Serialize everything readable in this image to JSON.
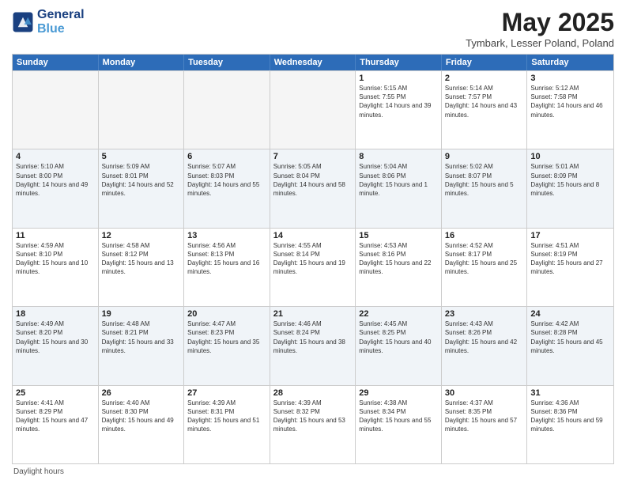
{
  "header": {
    "logo_general": "General",
    "logo_blue": "Blue",
    "main_title": "May 2025",
    "subtitle": "Tymbark, Lesser Poland, Poland"
  },
  "weekdays": [
    "Sunday",
    "Monday",
    "Tuesday",
    "Wednesday",
    "Thursday",
    "Friday",
    "Saturday"
  ],
  "footer_note": "Daylight hours",
  "rows": [
    [
      {
        "day": "",
        "empty": true
      },
      {
        "day": "",
        "empty": true
      },
      {
        "day": "",
        "empty": true
      },
      {
        "day": "",
        "empty": true
      },
      {
        "day": "1",
        "sunrise": "5:15 AM",
        "sunset": "7:55 PM",
        "daylight": "14 hours and 39 minutes."
      },
      {
        "day": "2",
        "sunrise": "5:14 AM",
        "sunset": "7:57 PM",
        "daylight": "14 hours and 43 minutes."
      },
      {
        "day": "3",
        "sunrise": "5:12 AM",
        "sunset": "7:58 PM",
        "daylight": "14 hours and 46 minutes."
      }
    ],
    [
      {
        "day": "4",
        "sunrise": "5:10 AM",
        "sunset": "8:00 PM",
        "daylight": "14 hours and 49 minutes."
      },
      {
        "day": "5",
        "sunrise": "5:09 AM",
        "sunset": "8:01 PM",
        "daylight": "14 hours and 52 minutes."
      },
      {
        "day": "6",
        "sunrise": "5:07 AM",
        "sunset": "8:03 PM",
        "daylight": "14 hours and 55 minutes."
      },
      {
        "day": "7",
        "sunrise": "5:05 AM",
        "sunset": "8:04 PM",
        "daylight": "14 hours and 58 minutes."
      },
      {
        "day": "8",
        "sunrise": "5:04 AM",
        "sunset": "8:06 PM",
        "daylight": "15 hours and 1 minute."
      },
      {
        "day": "9",
        "sunrise": "5:02 AM",
        "sunset": "8:07 PM",
        "daylight": "15 hours and 5 minutes."
      },
      {
        "day": "10",
        "sunrise": "5:01 AM",
        "sunset": "8:09 PM",
        "daylight": "15 hours and 8 minutes."
      }
    ],
    [
      {
        "day": "11",
        "sunrise": "4:59 AM",
        "sunset": "8:10 PM",
        "daylight": "15 hours and 10 minutes."
      },
      {
        "day": "12",
        "sunrise": "4:58 AM",
        "sunset": "8:12 PM",
        "daylight": "15 hours and 13 minutes."
      },
      {
        "day": "13",
        "sunrise": "4:56 AM",
        "sunset": "8:13 PM",
        "daylight": "15 hours and 16 minutes."
      },
      {
        "day": "14",
        "sunrise": "4:55 AM",
        "sunset": "8:14 PM",
        "daylight": "15 hours and 19 minutes."
      },
      {
        "day": "15",
        "sunrise": "4:53 AM",
        "sunset": "8:16 PM",
        "daylight": "15 hours and 22 minutes."
      },
      {
        "day": "16",
        "sunrise": "4:52 AM",
        "sunset": "8:17 PM",
        "daylight": "15 hours and 25 minutes."
      },
      {
        "day": "17",
        "sunrise": "4:51 AM",
        "sunset": "8:19 PM",
        "daylight": "15 hours and 27 minutes."
      }
    ],
    [
      {
        "day": "18",
        "sunrise": "4:49 AM",
        "sunset": "8:20 PM",
        "daylight": "15 hours and 30 minutes."
      },
      {
        "day": "19",
        "sunrise": "4:48 AM",
        "sunset": "8:21 PM",
        "daylight": "15 hours and 33 minutes."
      },
      {
        "day": "20",
        "sunrise": "4:47 AM",
        "sunset": "8:23 PM",
        "daylight": "15 hours and 35 minutes."
      },
      {
        "day": "21",
        "sunrise": "4:46 AM",
        "sunset": "8:24 PM",
        "daylight": "15 hours and 38 minutes."
      },
      {
        "day": "22",
        "sunrise": "4:45 AM",
        "sunset": "8:25 PM",
        "daylight": "15 hours and 40 minutes."
      },
      {
        "day": "23",
        "sunrise": "4:43 AM",
        "sunset": "8:26 PM",
        "daylight": "15 hours and 42 minutes."
      },
      {
        "day": "24",
        "sunrise": "4:42 AM",
        "sunset": "8:28 PM",
        "daylight": "15 hours and 45 minutes."
      }
    ],
    [
      {
        "day": "25",
        "sunrise": "4:41 AM",
        "sunset": "8:29 PM",
        "daylight": "15 hours and 47 minutes."
      },
      {
        "day": "26",
        "sunrise": "4:40 AM",
        "sunset": "8:30 PM",
        "daylight": "15 hours and 49 minutes."
      },
      {
        "day": "27",
        "sunrise": "4:39 AM",
        "sunset": "8:31 PM",
        "daylight": "15 hours and 51 minutes."
      },
      {
        "day": "28",
        "sunrise": "4:39 AM",
        "sunset": "8:32 PM",
        "daylight": "15 hours and 53 minutes."
      },
      {
        "day": "29",
        "sunrise": "4:38 AM",
        "sunset": "8:34 PM",
        "daylight": "15 hours and 55 minutes."
      },
      {
        "day": "30",
        "sunrise": "4:37 AM",
        "sunset": "8:35 PM",
        "daylight": "15 hours and 57 minutes."
      },
      {
        "day": "31",
        "sunrise": "4:36 AM",
        "sunset": "8:36 PM",
        "daylight": "15 hours and 59 minutes."
      }
    ]
  ]
}
